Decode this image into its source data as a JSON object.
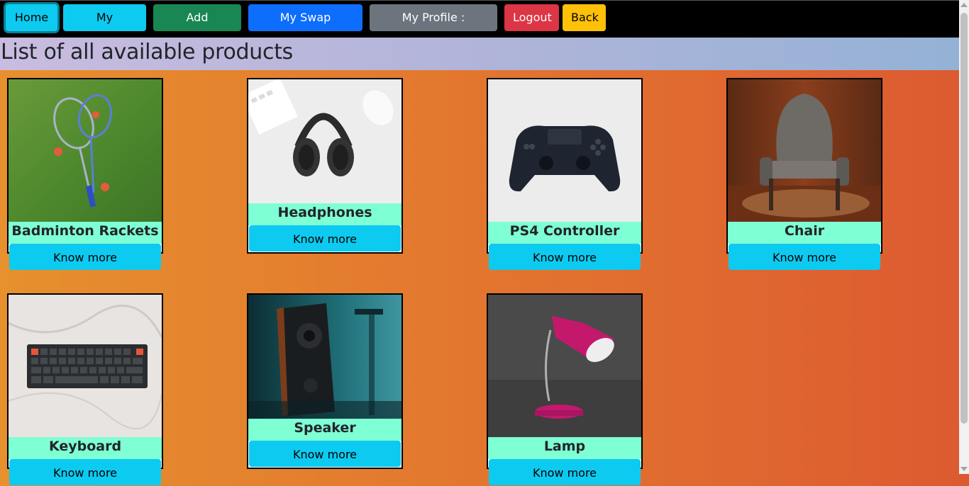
{
  "nav": {
    "home": "Home",
    "my_products": "My Products",
    "add_products": "Add Products",
    "swap_requests": "My Swap Requests",
    "profile": "My Profile : Shubham",
    "logout": "Logout",
    "back": "Back"
  },
  "page_title": "List of all available products",
  "products": [
    {
      "name": "Badminton Rackets",
      "button": "Know more",
      "image": "badminton-rackets-photo"
    },
    {
      "name": "Headphones",
      "button": "Know more",
      "image": "headphones-photo"
    },
    {
      "name": "PS4 Controller",
      "button": "Know more",
      "image": "ps4-controller-photo"
    },
    {
      "name": "Chair",
      "button": "Know more",
      "image": "chair-photo"
    },
    {
      "name": "Keyboard",
      "button": "Know more",
      "image": "keyboard-photo"
    },
    {
      "name": "Speaker",
      "button": "Know more",
      "image": "speaker-photo"
    },
    {
      "name": "Lamp",
      "button": "Know more",
      "image": "lamp-photo"
    }
  ],
  "colors": {
    "nav_bg": "#000000",
    "card_name_bg": "#7fffd4",
    "know_button": "#0dcaf0"
  }
}
